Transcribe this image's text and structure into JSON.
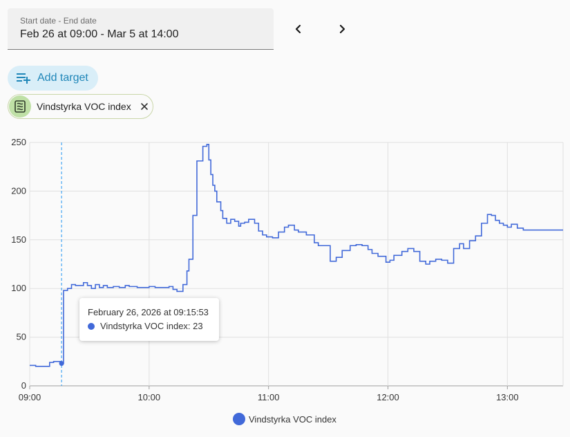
{
  "date_picker": {
    "label": "Start date - End date",
    "value": "Feb 26 at 09:00 - Mar 5 at 14:00"
  },
  "nav": {
    "prev_icon": "chevron-left-icon",
    "next_icon": "chevron-right-icon"
  },
  "add_target": {
    "label": "Add target",
    "icon": "playlist-plus-icon",
    "color": "#1f86b8",
    "background": "#d9eef8"
  },
  "target_chip": {
    "label": "Vindstyrka VOC index",
    "icon": "air-filter-icon",
    "remove_icon": "close-icon"
  },
  "tooltip": {
    "title": "February 26, 2026 at 09:15:53",
    "text": "Vindstyrka VOC index: 23"
  },
  "legend": {
    "label": "Vindstyrka VOC index",
    "color": "#4169d9"
  },
  "chart_data": {
    "type": "line",
    "step": true,
    "color": "#4169d9",
    "x_ticks": [
      "09:00",
      "10:00",
      "11:00",
      "12:00",
      "13:00"
    ],
    "x_tick_minutes": [
      0,
      60,
      120,
      180,
      240
    ],
    "xlim_minutes": [
      0,
      268
    ],
    "ylim": [
      0,
      250
    ],
    "y_ticks": [
      0,
      50,
      100,
      150,
      200,
      250
    ],
    "grid": true,
    "legend_position": "bottom-center",
    "highlight": {
      "x_minutes": 16,
      "y": 23
    },
    "series": [
      {
        "name": "Vindstyrka VOC index",
        "x_minutes": [
          0,
          3,
          10,
          12,
          16,
          17,
          19,
          21,
          23,
          27,
          29,
          31,
          33,
          35,
          37,
          39,
          42,
          45,
          48,
          50,
          54,
          60,
          63,
          70,
          72,
          74,
          77,
          79,
          80,
          82,
          84,
          87,
          89,
          90,
          91,
          92,
          93,
          94,
          96,
          97,
          99,
          101,
          103,
          105,
          106,
          108,
          110,
          113,
          115,
          117,
          119,
          122,
          125,
          128,
          130,
          133,
          135,
          139,
          143,
          145,
          148,
          151,
          154,
          157,
          161,
          164,
          167,
          170,
          172,
          175,
          179,
          181,
          183,
          187,
          190,
          193,
          196,
          199,
          201,
          204,
          207,
          210,
          213,
          216,
          218,
          221,
          224,
          227,
          230,
          232,
          234,
          236,
          238,
          240,
          242,
          245,
          248,
          251,
          254,
          257,
          261,
          264,
          267
        ],
        "values": [
          21,
          20,
          24,
          25,
          23,
          98,
          100,
          104,
          103,
          106,
          103,
          100,
          104,
          101,
          103,
          101,
          102,
          101,
          103,
          102,
          101,
          102,
          101,
          102,
          99,
          97,
          104,
          118,
          130,
          175,
          231,
          246,
          248,
          232,
          217,
          206,
          200,
          189,
          180,
          172,
          167,
          171,
          169,
          164,
          167,
          168,
          171,
          167,
          159,
          155,
          153,
          152,
          158,
          163,
          165,
          160,
          158,
          155,
          147,
          144,
          144,
          128,
          132,
          139,
          144,
          145,
          144,
          140,
          136,
          133,
          127,
          129,
          134,
          138,
          141,
          138,
          128,
          125,
          128,
          130,
          129,
          126,
          141,
          146,
          141,
          149,
          154,
          167,
          176,
          175,
          170,
          167,
          165,
          163,
          166,
          162,
          160,
          160,
          160,
          160,
          160,
          160,
          160
        ]
      }
    ]
  }
}
